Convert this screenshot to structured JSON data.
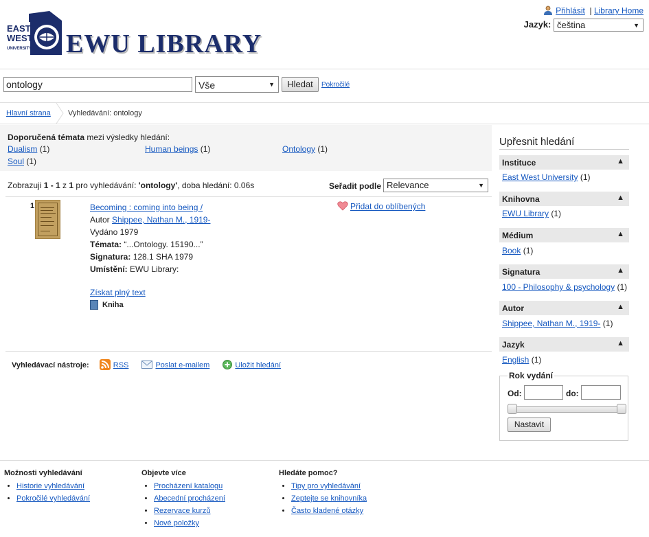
{
  "header": {
    "logo_emblem_text": [
      "EAST",
      "WEST",
      "UNIVERSITY"
    ],
    "logo_text": "EWU LIBRARY",
    "login_link": "Přihlásit",
    "separator": "|",
    "library_home_link": "Library Home",
    "language_label": "Jazyk:",
    "language_value": "čeština"
  },
  "search": {
    "query": "ontology",
    "scope": "Vše",
    "button": "Hledat",
    "advanced": "Pokročilé"
  },
  "breadcrumb": {
    "home": "Hlavní strana",
    "current": "Vyhledávání: ontology"
  },
  "topics": {
    "heading_bold": "Doporučená témata",
    "heading_rest": " mezi výsledky hledání:",
    "items": [
      {
        "label": "Dualism",
        "count": "(1)"
      },
      {
        "label": "Human beings",
        "count": "(1)"
      },
      {
        "label": "Ontology",
        "count": "(1)"
      },
      {
        "label": "Soul",
        "count": "(1)"
      }
    ]
  },
  "summary": {
    "prefix": "Zobrazuji ",
    "range": "1 - 1",
    "of": " z ",
    "total": "1",
    "middle": " pro vyhledávání: ",
    "query": "'ontology'",
    "suffix": ", doba hledání: 0.06s",
    "sort_label": "Seřadit podle",
    "sort_value": "Relevance"
  },
  "result": {
    "number": "1",
    "title": "Becoming : coming into being /",
    "author_label": "Autor",
    "author": "Shippee, Nathan M., 1919-",
    "published": "Vydáno 1979",
    "topics_label": "Témata:",
    "topics_value": "“...Ontology. 15190...”",
    "callnumber_label": "Signatura:",
    "callnumber_value": "128.1 SHA 1979",
    "location_label": "Umístění:",
    "location_value": "EWU Library:",
    "favorite": "Přidat do oblíbených",
    "fulltext": "Získat plný text",
    "format": "Kniha"
  },
  "tools": {
    "label": "Vyhledávací nástroje:",
    "rss": "RSS",
    "email": "Poslat e-mailem",
    "save": "Uložit hledání"
  },
  "facets": {
    "title": "Upřesnit hledání",
    "groups": [
      {
        "label": "Instituce",
        "item": "East West University",
        "count": "(1)"
      },
      {
        "label": "Knihovna",
        "item": "EWU Library",
        "count": "(1)"
      },
      {
        "label": "Médium",
        "item": "Book",
        "count": "(1)"
      },
      {
        "label": "Signatura",
        "item": "100 - Philosophy & psychology",
        "count": "(1)"
      },
      {
        "label": "Autor",
        "item": "Shippee, Nathan M., 1919-",
        "count": "(1)"
      },
      {
        "label": "Jazyk",
        "item": "English",
        "count": "(1)"
      }
    ],
    "year": {
      "legend": "Rok vydání",
      "from_label": "Od:",
      "to_label": "do:",
      "button": "Nastavit"
    }
  },
  "footer": {
    "col1": {
      "title": "Možnosti vyhledávání",
      "links": [
        "Historie vyhledávání",
        "Pokročilé vyhledávání"
      ]
    },
    "col2": {
      "title": "Objevte více",
      "links": [
        "Procházení katalogu",
        "Abecední procházení",
        "Rezervace kurzů",
        "Nové položky"
      ]
    },
    "col3": {
      "title": "Hledáte pomoc?",
      "links": [
        "Tipy pro vyhledávání",
        "Zeptejte se knihovníka",
        "Často kladené otázky"
      ]
    }
  },
  "colors": {
    "link": "#1558c0",
    "logo": "#1c2d6b",
    "facet_header_bg": "#e8e8e8"
  }
}
